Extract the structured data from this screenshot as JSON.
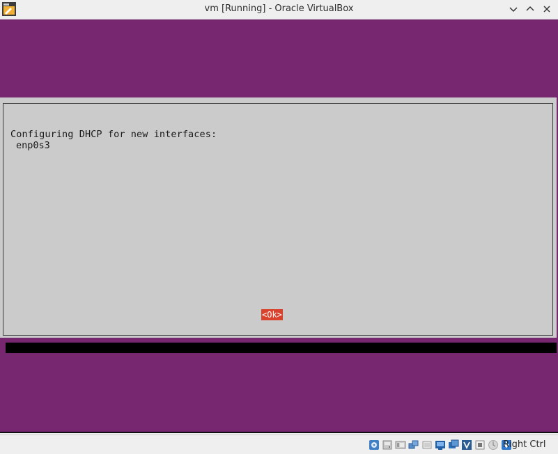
{
  "window": {
    "title": "vm [Running] - Oracle VirtualBox",
    "controls": [
      "minimize",
      "maximize",
      "close"
    ]
  },
  "dialog": {
    "line1": "Configuring DHCP for new interfaces:",
    "line2": "enp0s3",
    "ok_label": "<Ok>"
  },
  "statusbar": {
    "icons": [
      "optical-drive-icon",
      "hard-disk-icon",
      "audio-icon",
      "network-icon",
      "usb-icon",
      "shared-folders-icon",
      "display-icon",
      "video-capture-icon",
      "cpu-icon",
      "mouse-integration-icon",
      "host-key-arrow-icon"
    ],
    "host_key": "Right Ctrl"
  },
  "colors": {
    "desktop_purple": "#772670",
    "dialog_gray": "#cbcbcb",
    "ok_red": "#d9422d"
  }
}
